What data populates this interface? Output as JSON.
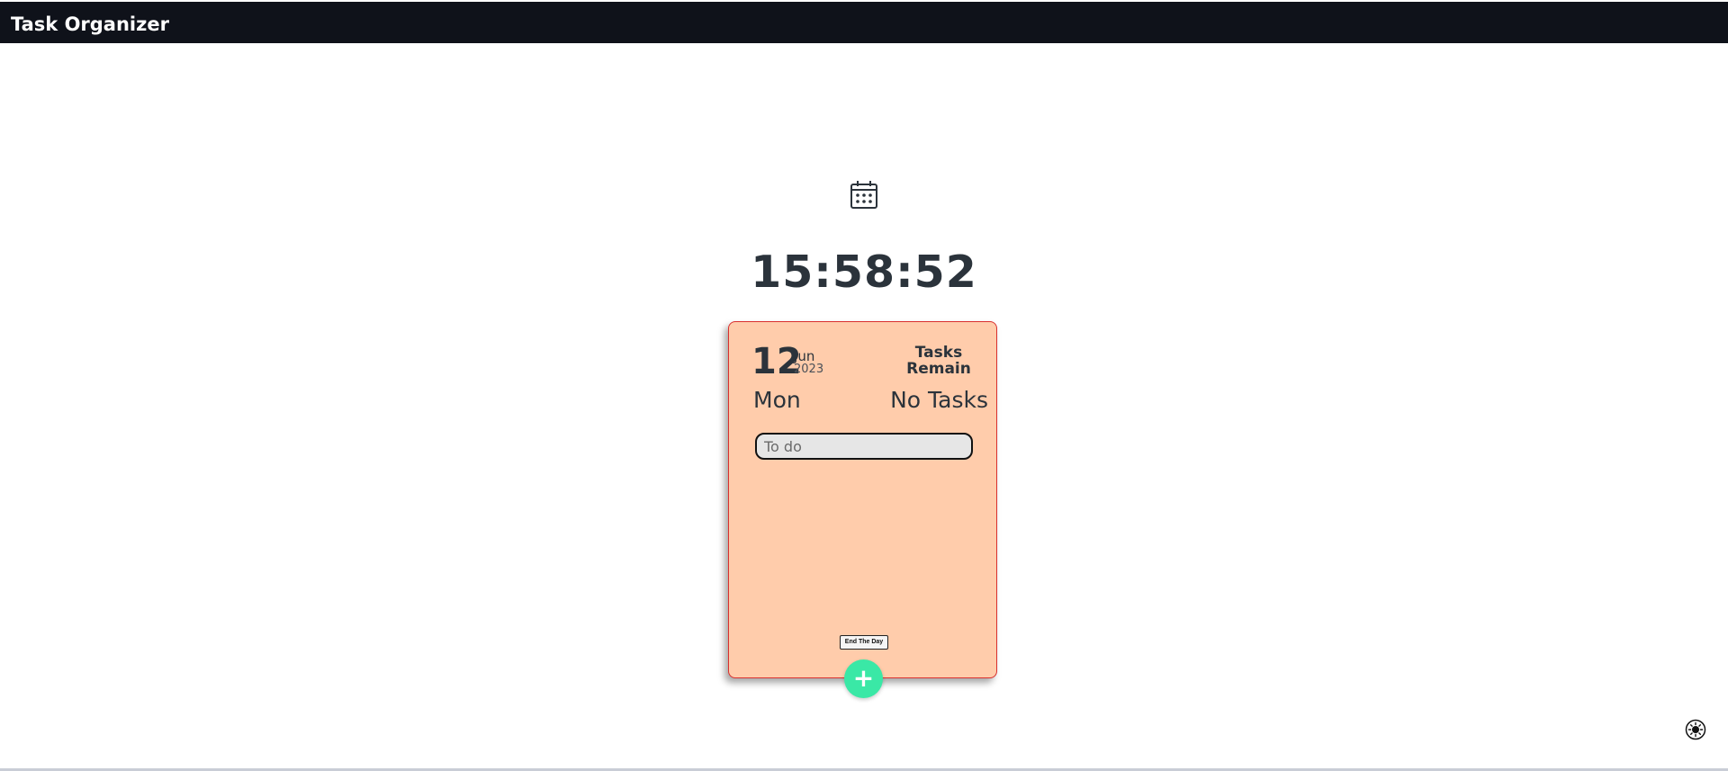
{
  "app": {
    "title": "Task Organizer"
  },
  "clock": {
    "time": "15:58:52"
  },
  "icons": {
    "calendar": "calendar-icon",
    "add": "plus-icon",
    "theme": "sun-icon"
  },
  "card": {
    "day": "12",
    "month": "Jun",
    "year": "2023",
    "weekday": "Mon",
    "tasks_title": "Tasks Remain",
    "tasks_count": "No Tasks",
    "todo_placeholder": "To do",
    "todo_value": "",
    "end_day_label": "End The Day",
    "add_label": "+"
  },
  "colors": {
    "navbar": "#0f121a",
    "card_background": "#ffccab",
    "card_border": "#d9302f",
    "add_button": "#3ae8a6",
    "text_dark": "#2b333b"
  }
}
